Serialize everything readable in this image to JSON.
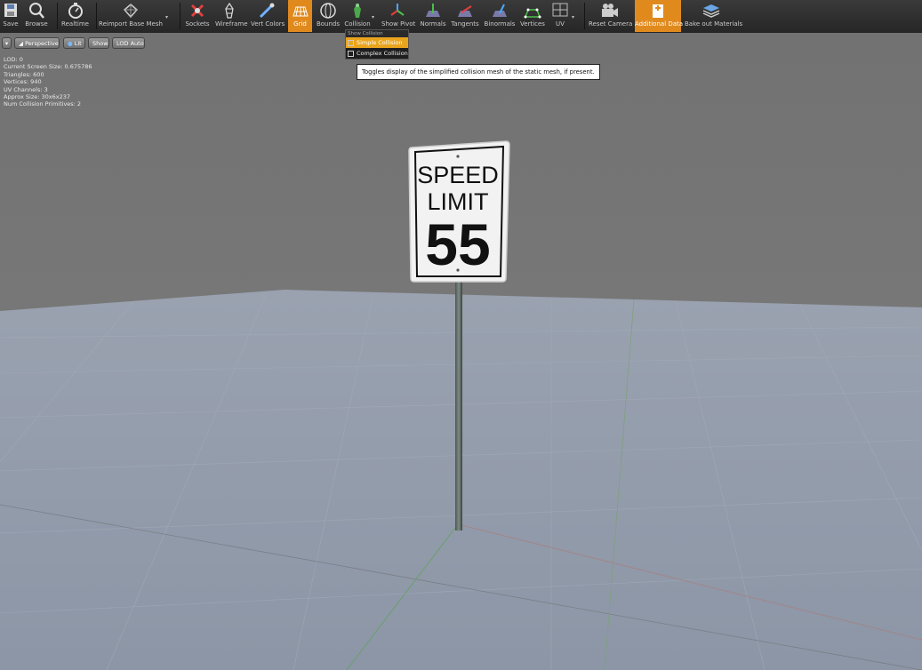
{
  "toolbar": {
    "buttons": [
      {
        "label": "Save",
        "icon": "save-icon"
      },
      {
        "label": "Browse",
        "icon": "browse-icon"
      },
      {
        "label": "Realtime",
        "icon": "realtime-icon"
      },
      {
        "label": "Reimport Base Mesh",
        "icon": "reimport-icon"
      },
      {
        "label": "Sockets",
        "icon": "sockets-icon"
      },
      {
        "label": "Wireframe",
        "icon": "wireframe-icon"
      },
      {
        "label": "Vert Colors",
        "icon": "vert-colors-icon"
      },
      {
        "label": "Grid",
        "icon": "grid-icon"
      },
      {
        "label": "Bounds",
        "icon": "bounds-icon"
      },
      {
        "label": "Collision",
        "icon": "collision-icon"
      },
      {
        "label": "Show Pivot",
        "icon": "pivot-icon"
      },
      {
        "label": "Normals",
        "icon": "normals-icon"
      },
      {
        "label": "Tangents",
        "icon": "tangents-icon"
      },
      {
        "label": "Binormals",
        "icon": "binormals-icon"
      },
      {
        "label": "Vertices",
        "icon": "vertices-icon"
      },
      {
        "label": "UV",
        "icon": "uv-icon"
      },
      {
        "label": "Reset Camera",
        "icon": "camera-icon"
      },
      {
        "label": "Additional Data",
        "icon": "additional-data-icon"
      },
      {
        "label": "Bake out Materials",
        "icon": "bake-materials-icon"
      }
    ]
  },
  "viewport": {
    "menu_label": "",
    "perspective": "Perspective",
    "lit": "Lit",
    "show": "Show",
    "lod": "LOD Auto"
  },
  "stats": [
    "LOD: 0",
    "Current Screen Size: 0.675786",
    "Triangles: 600",
    "Vertices: 940",
    "UV Channels: 3",
    "Approx Size: 30x6x237",
    "Num Collision Primitives: 2"
  ],
  "collision_menu": {
    "header": "Show Collision",
    "items": [
      {
        "label": "Simple Collision",
        "highlighted": true
      },
      {
        "label": "Complex Collision",
        "highlighted": false
      }
    ]
  },
  "tooltip": "Toggles display of the simplified collision mesh of the static mesh, if present.",
  "sign": {
    "line1": "SPEED",
    "line2": "LIMIT",
    "number": "55"
  },
  "colors": {
    "accent": "#e08a1e",
    "menu_highlight": "#e9a41d",
    "floor": "#8e98a8",
    "sky": "#7a7a7a"
  }
}
